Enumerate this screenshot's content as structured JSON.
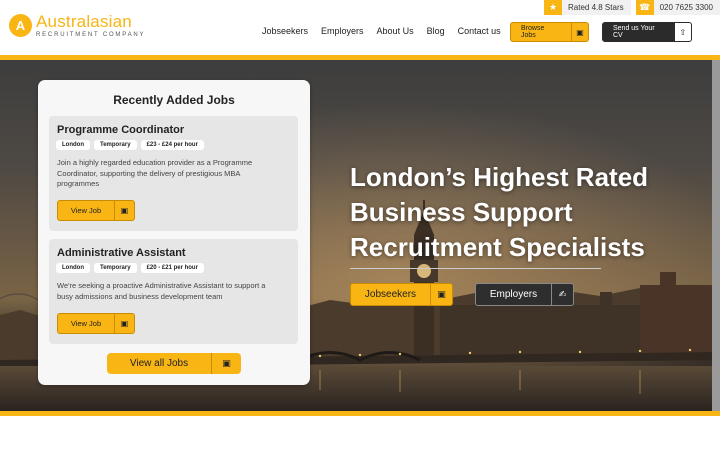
{
  "topbar": {
    "rating": "Rated 4.8 Stars",
    "phone": "020 7625 3300"
  },
  "brand": {
    "name": "Australasian",
    "tagline": "RECRUITMENT COMPANY",
    "mark": "A"
  },
  "nav": [
    "Jobseekers",
    "Employers",
    "About Us",
    "Blog",
    "Contact us"
  ],
  "header_buttons": {
    "browse": "Browse Jobs",
    "cv": "Send us Your CV"
  },
  "jobs_panel": {
    "title": "Recently Added Jobs",
    "jobs": [
      {
        "title": "Programme Coordinator",
        "tags": [
          "London",
          "Temporary",
          "£23 - £24 per hour"
        ],
        "description": "Join a highly regarded education provider as a Programme Coordinator, supporting the delivery of prestigious MBA programmes",
        "button": "View Job"
      },
      {
        "title": "Administrative Assistant",
        "tags": [
          "London",
          "Temporary",
          "£20 - £21 per hour"
        ],
        "description": "We're seeking a proactive Administrative Assistant to support a busy admissions and business development team",
        "button": "View Job"
      }
    ],
    "view_all": "View all Jobs"
  },
  "hero": {
    "headline_lines": [
      "London’s Highest Rated",
      "Business Support",
      "Recruitment Specialists"
    ],
    "buttons": {
      "jobseekers": "Jobseekers",
      "employers": "Employers"
    }
  },
  "icons": {
    "star": "star-icon",
    "phone": "phone-icon",
    "briefcase": "briefcase-icon",
    "upload": "upload-icon",
    "handshake": "handshake-icon"
  },
  "colors": {
    "accent": "#f8b514",
    "dark": "#2b2b2b"
  }
}
